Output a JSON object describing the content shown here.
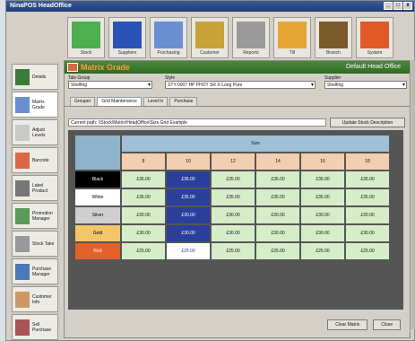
{
  "window": {
    "title": "NinaPOS HeadOffice"
  },
  "toolbar": [
    {
      "label": "Stock",
      "icon": "stock-icon"
    },
    {
      "label": "Suppliers",
      "icon": "truck-icon"
    },
    {
      "label": "Purchasing",
      "icon": "purchasing-icon"
    },
    {
      "label": "Customer",
      "icon": "customer-icon"
    },
    {
      "label": "Reports",
      "icon": "reports-icon"
    },
    {
      "label": "Till",
      "icon": "till-icon"
    },
    {
      "label": "Branch",
      "icon": "tree-icon"
    },
    {
      "label": "System",
      "icon": "system-icon"
    }
  ],
  "sidebar": [
    {
      "label": "Details",
      "icon": "details-icon"
    },
    {
      "label": "Matrix Grade",
      "icon": "matrix-icon"
    },
    {
      "label": "Adjust Levels",
      "icon": "adjust-icon"
    },
    {
      "label": "Barcode",
      "icon": "barcode-icon"
    },
    {
      "label": "Label Product",
      "icon": "label-icon"
    },
    {
      "label": "Promotion Manager",
      "icon": "promotion-icon"
    },
    {
      "label": "Stock Take",
      "icon": "stocktake-icon"
    },
    {
      "label": "Purchase Manager",
      "icon": "purchase-manager-icon"
    },
    {
      "label": "Customer Info",
      "icon": "customer-info-icon"
    },
    {
      "label": "Sell Purchase",
      "icon": "sell-icon"
    }
  ],
  "header": {
    "title": "Matrix Grade",
    "office": "Default Head Office"
  },
  "filters": {
    "group": {
      "label": "Tale Group",
      "value": "Shelfing"
    },
    "desc": {
      "label": "Style",
      "value": "STY-0007 HP PHOT SR X-Long Pure"
    },
    "supplier": {
      "label": "Supplier",
      "value": "Shelfing"
    }
  },
  "tabs": [
    "Grouper",
    "Grid Maintenance",
    "Level In",
    "Purchase"
  ],
  "path": "Current path: \\\\Stock\\Matrix\\HeadOffice\\Size Grid Example",
  "update_button": "Update Stock Description",
  "grid": {
    "size_title": "Size",
    "sizes": [
      "8",
      "10",
      "12",
      "14",
      "16",
      "18"
    ],
    "colours": [
      {
        "name": "Black",
        "color": "#000000",
        "text_color": "#ffffff"
      },
      {
        "name": "White",
        "color": "#ffffff",
        "text_color": "#000000"
      },
      {
        "name": "Silver",
        "color": "#cfcfcf",
        "text_color": "#000000"
      },
      {
        "name": "Gold",
        "color": "#f4c56a",
        "text_color": "#000000"
      },
      {
        "name": "Red",
        "color": "#e4622a",
        "text_color": "#ffffff"
      }
    ],
    "values": [
      [
        "£35.00",
        "£35.00",
        "£35.00",
        "£35.00",
        "£35.00",
        "£35.00"
      ],
      [
        "£35.00",
        "£35.00",
        "£35.00",
        "£35.00",
        "£35.00",
        "£35.00"
      ],
      [
        "£30.00",
        "£30.00",
        "£30.00",
        "£30.00",
        "£30.00",
        "£30.00"
      ],
      [
        "£30.00",
        "£30.00",
        "£30.00",
        "£30.00",
        "£30.00",
        "£30.00"
      ],
      [
        "£25.00",
        "£25.00",
        "£25.00",
        "£25.00",
        "£25.00",
        "£25.00"
      ]
    ]
  },
  "buttons": {
    "clear": "Clear Matrix",
    "close": "Close"
  }
}
